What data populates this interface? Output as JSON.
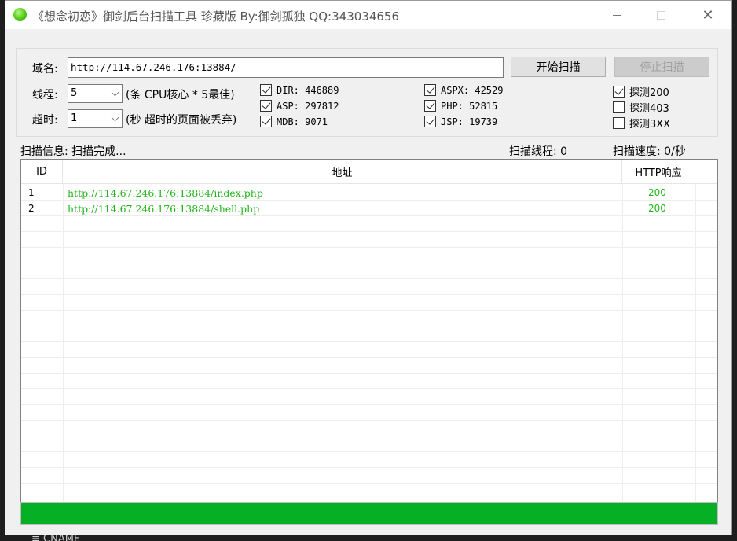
{
  "window": {
    "title": "《想念初恋》御剑后台扫描工具 珍藏版 By:御剑孤独 QQ:343034656"
  },
  "form": {
    "domain_label": "域名:",
    "domain_value": "http://114.67.246.176:13884/",
    "start_button": "开始扫描",
    "stop_button": "停止扫描",
    "threads_label": "线程:",
    "threads_value": "5",
    "threads_hint": "(条 CPU核心 * 5最佳)",
    "timeout_label": "超时:",
    "timeout_value": "1",
    "timeout_hint": "(秒 超时的页面被丢弃)"
  },
  "dictionaries": [
    {
      "label": "DIR: 446889",
      "checked": true
    },
    {
      "label": "ASP: 297812",
      "checked": true
    },
    {
      "label": "MDB: 9071",
      "checked": true
    },
    {
      "label": "ASPX: 42529",
      "checked": true
    },
    {
      "label": "PHP: 52815",
      "checked": true
    },
    {
      "label": "JSP: 19739",
      "checked": true
    }
  ],
  "probes": [
    {
      "label": "探测200",
      "checked": true
    },
    {
      "label": "探测403",
      "checked": false
    },
    {
      "label": "探测3XX",
      "checked": false
    }
  ],
  "status": {
    "info": "扫描信息: 扫描完成...",
    "threads": "扫描线程: 0",
    "speed": "扫描速度: 0/秒"
  },
  "table": {
    "columns": [
      "ID",
      "地址",
      "HTTP响应"
    ],
    "rows": [
      {
        "id": "1",
        "url": "http://114.67.246.176:13884/index.php",
        "code": "200"
      },
      {
        "id": "2",
        "url": "http://114.67.246.176:13884/shell.php",
        "code": "200"
      }
    ]
  },
  "progress": {
    "value": 1.0
  },
  "background": {
    "text": "≡ CNAME"
  },
  "colors": {
    "accent_green": "#06b025",
    "result_text": "#22b51d"
  }
}
